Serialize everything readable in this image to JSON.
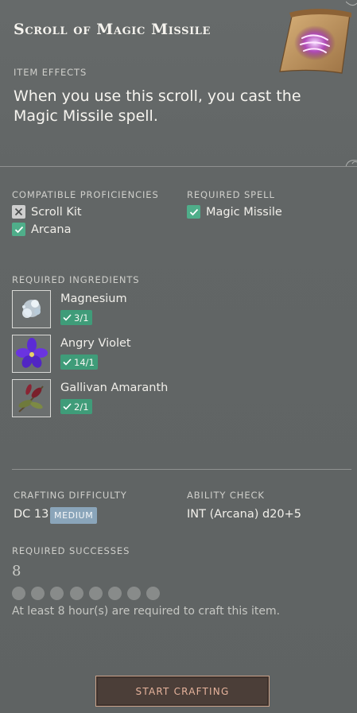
{
  "item": {
    "title": "Scroll of Magic Missile",
    "effects_label": "ITEM EFFECTS",
    "effects_text": "When you use this scroll, you cast the Magic Missile spell."
  },
  "proficiencies": {
    "label": "COMPATIBLE PROFICIENCIES",
    "items": [
      {
        "label": "Scroll Kit",
        "checked": false
      },
      {
        "label": "Arcana",
        "checked": true
      }
    ]
  },
  "spell": {
    "label": "REQUIRED SPELL",
    "items": [
      {
        "label": "Magic Missile",
        "checked": true
      }
    ]
  },
  "ingredients": {
    "label": "REQUIRED INGREDIENTS",
    "items": [
      {
        "name": "Magnesium",
        "count": "3/1",
        "icon": "magnesium-icon"
      },
      {
        "name": "Angry Violet",
        "count": "14/1",
        "icon": "violet-flower-icon"
      },
      {
        "name": "Gallivan Amaranth",
        "count": "2/1",
        "icon": "amaranth-plant-icon"
      }
    ]
  },
  "crafting": {
    "difficulty_label": "CRAFTING DIFFICULTY",
    "dc": "DC 13",
    "difficulty_badge": "MEDIUM",
    "ability_label": "ABILITY CHECK",
    "ability": "INT (Arcana) d20+5",
    "successes_label": "REQUIRED SUCCESSES",
    "successes": "8",
    "successes_progress": 0,
    "note": "At least 8 hour(s) are required to craft this item.",
    "button": "START CRAFTING"
  },
  "colors": {
    "check_on": "#4fae8a",
    "badge_green": "#3f9c79",
    "medium_badge": "#8aa5ba",
    "button_text": "#e6b39c"
  }
}
